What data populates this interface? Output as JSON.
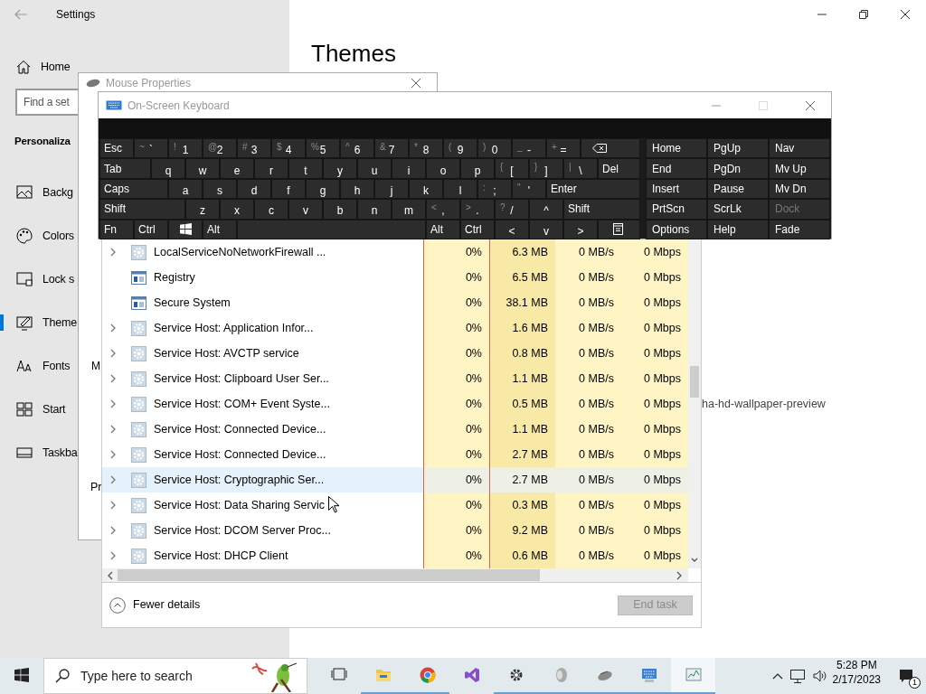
{
  "settings": {
    "title": "Settings",
    "home": "Home",
    "search": {
      "placeholder": "Find a set"
    },
    "section": "Personaliza",
    "items": [
      {
        "label": "Backg",
        "selected": false
      },
      {
        "label": "Colors",
        "selected": false
      },
      {
        "label": "Lock s",
        "selected": false
      },
      {
        "label": "Theme",
        "selected": true
      },
      {
        "label": "Fonts",
        "selected": false
      },
      {
        "label": "Start",
        "selected": false
      },
      {
        "label": "Taskba",
        "selected": false
      }
    ],
    "heading": "Themes",
    "caption": "ha-hd-wallpaper-preview"
  },
  "mouse_properties": {
    "title": "Mouse Properties",
    "fragments": [
      "M",
      "Pr"
    ]
  },
  "osk": {
    "title": "On-Screen Keyboard",
    "keys": [
      [
        {
          "kind": "mod",
          "label": "Esc"
        },
        {
          "kind": "char",
          "shift": "~",
          "label": "`"
        },
        {
          "kind": "char",
          "shift": "!",
          "label": "1"
        },
        {
          "kind": "char",
          "shift": "@",
          "label": "2"
        },
        {
          "kind": "char",
          "shift": "#",
          "label": "3"
        },
        {
          "kind": "char",
          "shift": "$",
          "label": "4"
        },
        {
          "kind": "char",
          "shift": "%",
          "label": "5"
        },
        {
          "kind": "char",
          "shift": "^",
          "label": "6"
        },
        {
          "kind": "char",
          "shift": "&",
          "label": "7"
        },
        {
          "kind": "char",
          "shift": "*",
          "label": "8"
        },
        {
          "kind": "char",
          "shift": "(",
          "label": "9"
        },
        {
          "kind": "char",
          "shift": ")",
          "label": "0"
        },
        {
          "kind": "char",
          "shift": "_",
          "label": "-"
        },
        {
          "kind": "char",
          "shift": "+",
          "label": "="
        },
        {
          "kind": "back"
        }
      ],
      [
        {
          "kind": "tab",
          "label": "Tab"
        },
        {
          "kind": "char",
          "label": "q"
        },
        {
          "kind": "char",
          "label": "w"
        },
        {
          "kind": "char",
          "label": "e"
        },
        {
          "kind": "char",
          "label": "r"
        },
        {
          "kind": "char",
          "label": "t"
        },
        {
          "kind": "char",
          "label": "y"
        },
        {
          "kind": "char",
          "label": "u"
        },
        {
          "kind": "char",
          "label": "i"
        },
        {
          "kind": "char",
          "label": "o"
        },
        {
          "kind": "char",
          "label": "p"
        },
        {
          "kind": "char",
          "shift": "{",
          "label": "["
        },
        {
          "kind": "char",
          "shift": "}",
          "label": "]"
        },
        {
          "kind": "char",
          "shift": "|",
          "label": "\\"
        },
        {
          "kind": "mod",
          "label": "Del"
        }
      ],
      [
        {
          "kind": "caps",
          "label": "Caps"
        },
        {
          "kind": "char",
          "label": "a"
        },
        {
          "kind": "char",
          "label": "s"
        },
        {
          "kind": "char",
          "label": "d"
        },
        {
          "kind": "char",
          "label": "f"
        },
        {
          "kind": "char",
          "label": "g"
        },
        {
          "kind": "char",
          "label": "h"
        },
        {
          "kind": "char",
          "label": "j"
        },
        {
          "kind": "char",
          "label": "k"
        },
        {
          "kind": "char",
          "label": "l"
        },
        {
          "kind": "char",
          "shift": ":",
          "label": ";"
        },
        {
          "kind": "char",
          "shift": "\"",
          "label": "'"
        },
        {
          "kind": "mod",
          "label": "Enter"
        }
      ],
      [
        {
          "kind": "shift",
          "label": "Shift"
        },
        {
          "kind": "char",
          "label": "z"
        },
        {
          "kind": "char",
          "label": "x"
        },
        {
          "kind": "char",
          "label": "c"
        },
        {
          "kind": "char",
          "label": "v"
        },
        {
          "kind": "char",
          "label": "b"
        },
        {
          "kind": "char",
          "label": "n"
        },
        {
          "kind": "char",
          "label": "m"
        },
        {
          "kind": "char",
          "shift": "<",
          "label": ","
        },
        {
          "kind": "char",
          "shift": ">",
          "label": "."
        },
        {
          "kind": "char",
          "shift": "?",
          "label": "/"
        },
        {
          "kind": "char",
          "label": "^"
        },
        {
          "kind": "mod",
          "label": "Shift"
        }
      ],
      [
        {
          "kind": "mod",
          "label": "Fn"
        },
        {
          "kind": "mod",
          "label": "Ctrl"
        },
        {
          "kind": "win"
        },
        {
          "kind": "mod",
          "label": "Alt"
        },
        {
          "kind": "space"
        },
        {
          "kind": "mod",
          "label": "Alt"
        },
        {
          "kind": "mod",
          "label": "Ctrl"
        },
        {
          "kind": "char",
          "label": "<"
        },
        {
          "kind": "char",
          "label": "v"
        },
        {
          "kind": "char",
          "label": ">"
        },
        {
          "kind": "menu"
        }
      ]
    ],
    "nav_keys": [
      [
        {
          "label": "Home",
          "disabled": false
        },
        {
          "label": "PgUp",
          "disabled": false
        },
        {
          "label": "Nav",
          "disabled": false
        }
      ],
      [
        {
          "label": "End",
          "disabled": false
        },
        {
          "label": "PgDn",
          "disabled": false
        },
        {
          "label": "Mv Up",
          "disabled": false
        }
      ],
      [
        {
          "label": "Insert",
          "disabled": false
        },
        {
          "label": "Pause",
          "disabled": false
        },
        {
          "label": "Mv Dn",
          "disabled": false
        }
      ],
      [
        {
          "label": "PrtScn",
          "disabled": false
        },
        {
          "label": "ScrLk",
          "disabled": false
        },
        {
          "label": "Dock",
          "disabled": true
        }
      ],
      [
        {
          "label": "Options",
          "disabled": false
        },
        {
          "label": "Help",
          "disabled": false
        },
        {
          "label": "Fade",
          "disabled": false
        }
      ]
    ]
  },
  "task_manager": {
    "rows": [
      {
        "name": "LocalServiceNoNetworkFirewall ...",
        "kind": "service",
        "expandable": true,
        "selected": false,
        "cpu": "0%",
        "memory": "6.3 MB",
        "disk": "0 MB/s",
        "network": "0 Mbps"
      },
      {
        "name": "Registry",
        "kind": "system",
        "expandable": false,
        "selected": false,
        "cpu": "0%",
        "memory": "6.5 MB",
        "disk": "0 MB/s",
        "network": "0 Mbps"
      },
      {
        "name": "Secure System",
        "kind": "system",
        "expandable": false,
        "selected": false,
        "cpu": "0%",
        "memory": "38.1 MB",
        "disk": "0 MB/s",
        "network": "0 Mbps"
      },
      {
        "name": "Service Host: Application Infor...",
        "kind": "service",
        "expandable": true,
        "selected": false,
        "cpu": "0%",
        "memory": "1.6 MB",
        "disk": "0 MB/s",
        "network": "0 Mbps"
      },
      {
        "name": "Service Host: AVCTP service",
        "kind": "service",
        "expandable": true,
        "selected": false,
        "cpu": "0%",
        "memory": "0.8 MB",
        "disk": "0 MB/s",
        "network": "0 Mbps"
      },
      {
        "name": "Service Host: Clipboard User Ser...",
        "kind": "service",
        "expandable": true,
        "selected": false,
        "cpu": "0%",
        "memory": "1.1 MB",
        "disk": "0 MB/s",
        "network": "0 Mbps"
      },
      {
        "name": "Service Host: COM+ Event Syste...",
        "kind": "service",
        "expandable": true,
        "selected": false,
        "cpu": "0%",
        "memory": "0.5 MB",
        "disk": "0 MB/s",
        "network": "0 Mbps"
      },
      {
        "name": "Service Host: Connected Device...",
        "kind": "service",
        "expandable": true,
        "selected": false,
        "cpu": "0%",
        "memory": "1.1 MB",
        "disk": "0 MB/s",
        "network": "0 Mbps"
      },
      {
        "name": "Service Host: Connected Device...",
        "kind": "service",
        "expandable": true,
        "selected": false,
        "cpu": "0%",
        "memory": "2.7 MB",
        "disk": "0 MB/s",
        "network": "0 Mbps"
      },
      {
        "name": "Service Host: Cryptographic Ser...",
        "kind": "service",
        "expandable": true,
        "selected": true,
        "cpu": "0%",
        "memory": "2.7 MB",
        "disk": "0 MB/s",
        "network": "0 Mbps"
      },
      {
        "name": "Service Host: Data Sharing Servic",
        "kind": "service",
        "expandable": true,
        "selected": false,
        "cpu": "0%",
        "memory": "0.3 MB",
        "disk": "0 MB/s",
        "network": "0 Mbps"
      },
      {
        "name": "Service Host: DCOM Server Proc...",
        "kind": "service",
        "expandable": true,
        "selected": false,
        "cpu": "0%",
        "memory": "9.2 MB",
        "disk": "0 MB/s",
        "network": "0 Mbps"
      },
      {
        "name": "Service Host: DHCP Client",
        "kind": "service",
        "expandable": true,
        "selected": false,
        "cpu": "0%",
        "memory": "0.6 MB",
        "disk": "0 MB/s",
        "network": "0 Mbps"
      }
    ],
    "fewer_details": "Fewer details",
    "end_task": {
      "label": "End task",
      "disabled": true
    }
  },
  "taskbar": {
    "search": {
      "placeholder": "Type here to search"
    },
    "apps": [
      {
        "running": false,
        "active": false
      },
      {
        "running": true,
        "active": false
      },
      {
        "running": true,
        "active": false
      },
      {
        "running": false,
        "active": false
      },
      {
        "running": true,
        "active": false
      },
      {
        "running": true,
        "active": false
      },
      {
        "running": true,
        "active": false
      },
      {
        "running": true,
        "active": false
      },
      {
        "running": true,
        "active": true
      }
    ],
    "time": "5:28 PM",
    "date": "2/17/2023",
    "notifications": "1"
  }
}
